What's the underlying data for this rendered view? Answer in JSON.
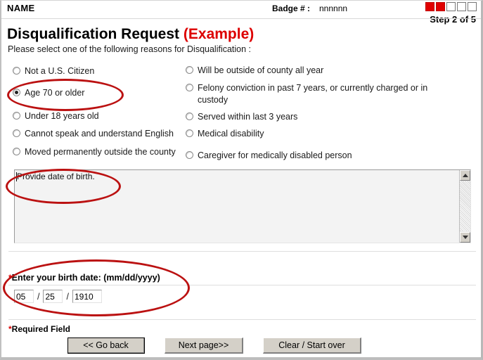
{
  "header": {
    "name": "NAME",
    "badge_label": "Badge # :",
    "badge_value": "nnnnnn",
    "step_label": "Step 2 of 5",
    "steps_total": 5,
    "steps_done": 2,
    "step_on_color": "#e00000"
  },
  "page": {
    "title": "Disqualification Request",
    "title_suffix": "(Example)",
    "title_suffix_color": "#dd0000",
    "instruction": "Please select one of the following reasons for Disqualification :"
  },
  "reasons": {
    "left": [
      {
        "label": "Not a U.S. Citizen",
        "selected": false
      },
      {
        "label": "Age 70 or older",
        "selected": true
      },
      {
        "label": "Under 18 years old",
        "selected": false
      },
      {
        "label": "Cannot speak and understand English",
        "selected": false
      },
      {
        "label": "Moved permanently outside the county",
        "selected": false
      }
    ],
    "right": [
      {
        "label": "Will be outside of county all year",
        "selected": false
      },
      {
        "label": "Felony conviction in past 7 years, or currently charged or in custody",
        "selected": false
      },
      {
        "label": "Served within last 3 years",
        "selected": false
      },
      {
        "label": "Medical disability",
        "selected": false
      },
      {
        "label": "Caregiver for medically disabled person",
        "selected": false
      }
    ]
  },
  "comment_box": {
    "value": "Provide date of birth.",
    "scroll_up_icon": "scroll-up-arrow-icon",
    "scroll_down_icon": "scroll-down-arrow-icon"
  },
  "birth_date": {
    "label": "Enter your birth date: (mm/dd/yyyy)",
    "required_marker": "*",
    "month": "05",
    "day": "25",
    "year": "1910",
    "separator": "/"
  },
  "footer": {
    "required_note": "Required Field",
    "required_marker": "*",
    "buttons": {
      "back": "<< Go back",
      "next": "Next page>>",
      "clear": "Clear / Start over"
    }
  },
  "annotations": {
    "color": "#bb1111",
    "items": [
      {
        "name": "highlight-age-70-or-older"
      },
      {
        "name": "highlight-provide-date-of-birth"
      },
      {
        "name": "highlight-enter-your-birth-date"
      }
    ]
  }
}
